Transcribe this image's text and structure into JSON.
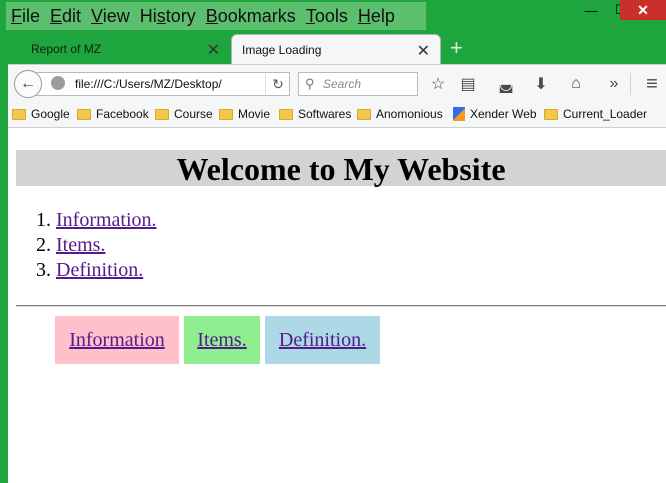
{
  "menubar": {
    "items": [
      {
        "pre": "",
        "u": "F",
        "post": "ile"
      },
      {
        "pre": "",
        "u": "E",
        "post": "dit"
      },
      {
        "pre": "",
        "u": "V",
        "post": "iew"
      },
      {
        "pre": "Hi",
        "u": "s",
        "post": "tory"
      },
      {
        "pre": "",
        "u": "B",
        "post": "ookmarks"
      },
      {
        "pre": "",
        "u": "T",
        "post": "ools"
      },
      {
        "pre": "",
        "u": "H",
        "post": "elp"
      }
    ]
  },
  "window_controls": {
    "minimize": "—",
    "maximize": "☐",
    "close": "✕"
  },
  "tabs": [
    {
      "title": "Report of MZ",
      "close": "✕"
    },
    {
      "title": "Image Loading",
      "close": "✕"
    }
  ],
  "new_tab_label": "+",
  "navbar": {
    "back": "←",
    "url": "file:///C:/Users/MZ/Desktop/",
    "reload": "↻",
    "search_placeholder": "Search",
    "search_icon": "⚲",
    "icons": {
      "star": "☆",
      "reading_list": "▤",
      "pocket": "◛",
      "download": "⬇",
      "home": "⌂",
      "overflow": "»",
      "menu": "≡"
    }
  },
  "bookmarks": [
    {
      "label": "Google",
      "icon": "folder"
    },
    {
      "label": "Facebook",
      "icon": "folder"
    },
    {
      "label": "Course",
      "icon": "folder"
    },
    {
      "label": "Movie",
      "icon": "folder"
    },
    {
      "label": "Softwares",
      "icon": "folder"
    },
    {
      "label": "Anomonious",
      "icon": "folder"
    },
    {
      "label": "Xender Web",
      "icon": "xender"
    },
    {
      "label": "Current_Loader",
      "icon": "folder"
    }
  ],
  "page": {
    "heading": "Welcome to My Website",
    "list": [
      "Information.",
      "Items.",
      "Definition."
    ],
    "boxes": [
      {
        "label": "Information",
        "color": "#ffc0cb"
      },
      {
        "label": "Items.",
        "color": "#90ee90"
      },
      {
        "label": "Definition.",
        "color": "#add8e6"
      }
    ]
  }
}
